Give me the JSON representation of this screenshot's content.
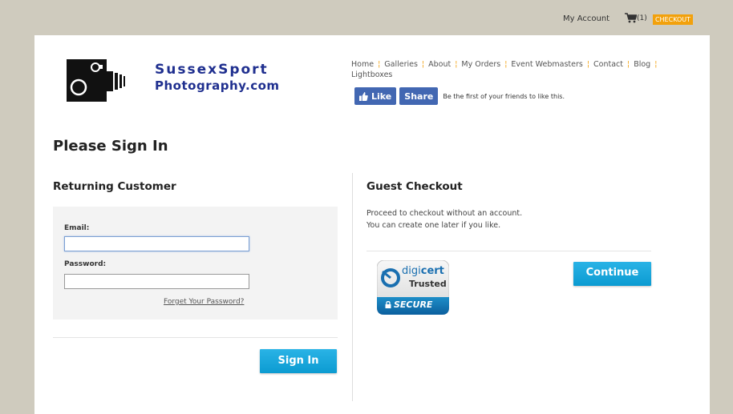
{
  "topbar": {
    "my_account": "My Account",
    "cart_count": "(1)",
    "checkout": "CHECKOUT"
  },
  "logo": {
    "line1": "SussexSport",
    "line2": "Photography.com"
  },
  "nav": {
    "items": [
      "Home",
      "Galleries",
      "About",
      "My Orders",
      "Event Webmasters",
      "Contact",
      "Blog",
      "Lightboxes"
    ]
  },
  "social": {
    "like": "Like",
    "share": "Share",
    "text": "Be the first of your friends to like this."
  },
  "page_title": "Please Sign In",
  "returning": {
    "title": "Returning Customer",
    "email_label": "Email:",
    "email_value": "",
    "password_label": "Password:",
    "password_value": "",
    "forgot": "Forget Your Password?",
    "sign_in": "Sign In"
  },
  "guest": {
    "title": "Guest Checkout",
    "line1": "Proceed to checkout without an account.",
    "line2": "You can create one later if you like.",
    "continue": "Continue"
  },
  "badge": {
    "brand_a": "digi",
    "brand_b": "cert",
    "trusted": "Trusted",
    "secure": "SECURE"
  },
  "colors": {
    "accent_orange": "#f2a10c",
    "button_blue": "#16a8de",
    "facebook_blue": "#4267b2",
    "logo_blue": "#1f2f8f"
  }
}
